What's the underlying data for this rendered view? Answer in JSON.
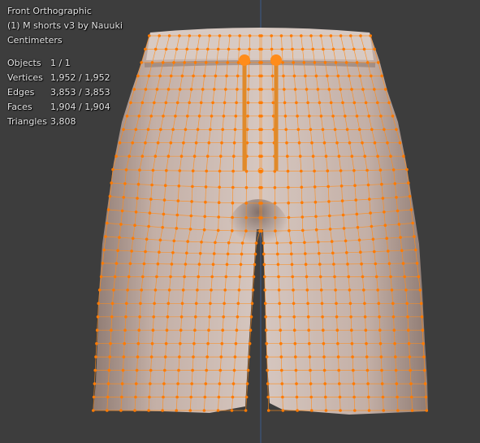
{
  "viewport": {
    "view_name": "Front Orthographic",
    "object_title": "(1) M shorts v3 by Nauuki",
    "units": "Centimeters"
  },
  "stats": [
    {
      "label": "Objects",
      "value": "1 / 1"
    },
    {
      "label": "Vertices",
      "value": "1,952 / 1,952"
    },
    {
      "label": "Edges",
      "value": "3,853 / 3,853"
    },
    {
      "label": "Faces",
      "value": "1,904 / 1,904"
    },
    {
      "label": "Triangles",
      "value": "3,808"
    }
  ],
  "colors": {
    "background": "#3d3d3d",
    "mesh_fill": "#c9b7ae",
    "selected_wire": "#ff8c1a",
    "selected_vertex": "#ff7a00",
    "axis_line": "#3b5a8a"
  }
}
